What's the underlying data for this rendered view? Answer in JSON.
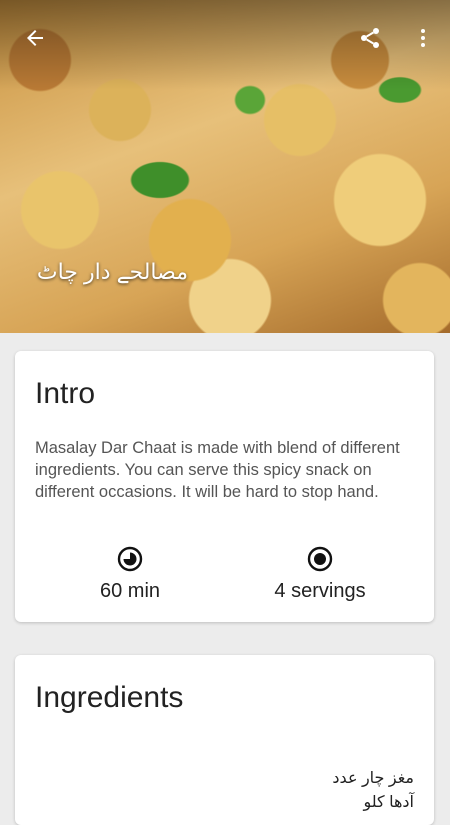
{
  "header": {
    "title": "مصالحے دار چاٹ",
    "image": "food-photo-chaat",
    "back_icon": "arrow-left-icon",
    "share_icon": "share-icon",
    "more_icon": "more-vertical-icon"
  },
  "intro": {
    "heading": "Intro",
    "text": "Masalay Dar Chaat is made with blend of different ingredients. You can serve this spicy snack on different occasions. It will be hard to stop hand.",
    "time": "60 min",
    "servings": "4 servings"
  },
  "ingredients": {
    "heading": "Ingredients",
    "items": [
      "مغز چار عدد",
      "آدھا کلو"
    ]
  }
}
